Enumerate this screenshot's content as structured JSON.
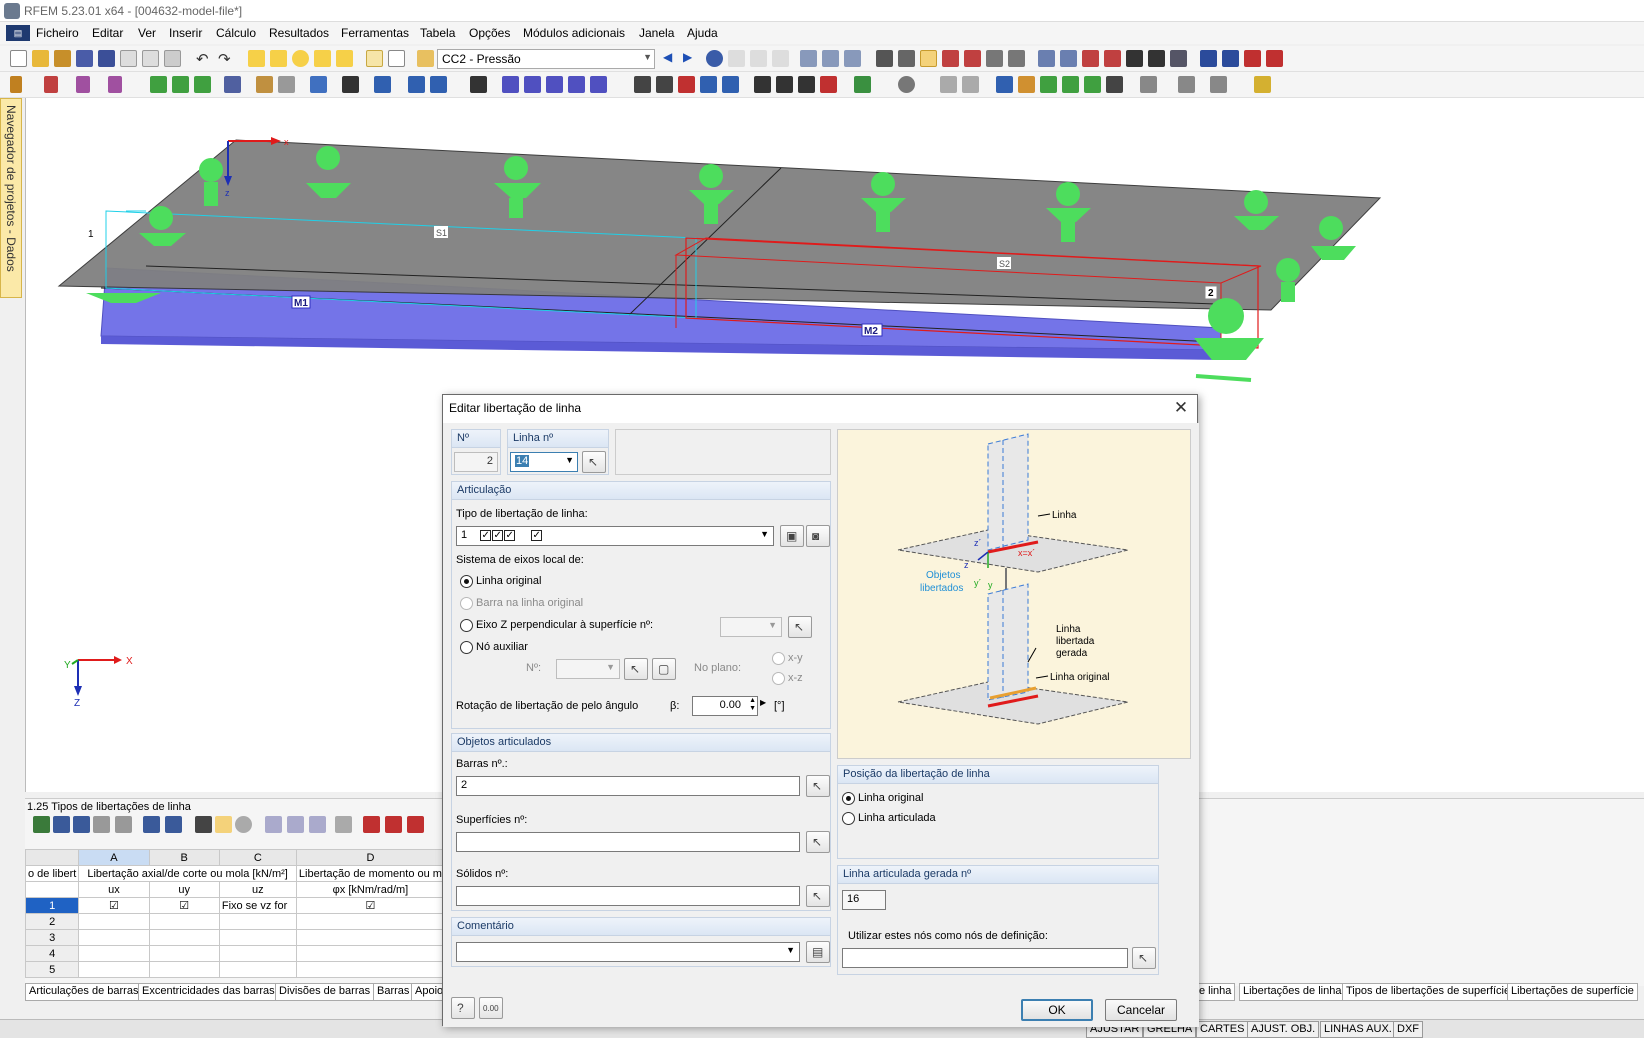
{
  "window": {
    "title": "RFEM 5.23.01 x64 - [004632-model-file*]"
  },
  "menu": [
    "Ficheiro",
    "Editar",
    "Ver",
    "Inserir",
    "Cálculo",
    "Resultados",
    "Ferramentas",
    "Tabela",
    "Opções",
    "Módulos adicionais",
    "Janela",
    "Ajuda"
  ],
  "toolbar": {
    "load_case": "CC2 - Pressão"
  },
  "navigator": {
    "label": "Navegador de projetos - Dados"
  },
  "viewport": {
    "labels": {
      "s1": "S1",
      "s2": "S2",
      "m1": "M1",
      "m2": "M2",
      "node1": "1",
      "node2": "2",
      "axis_x": "x",
      "axis_z": "z",
      "axis_y": "y",
      "axis2_x": "X",
      "axis2_y": "Y",
      "axis2_z": "Z"
    },
    "colors": {
      "slab": "#808080",
      "beam": "#6b6be8",
      "support": "#44dd55",
      "release": "#e01b1b",
      "cyan": "#20d0e8"
    }
  },
  "table_panel": {
    "title": "1.25 Tipos de libertações de linha",
    "col_letters": [
      "A",
      "B",
      "C",
      "D"
    ],
    "header1": [
      "o de libert",
      "Libertação axial/de corte ou mola [kN/m²]",
      "Libertação de momento ou m"
    ],
    "header2": [
      "ux",
      "uy",
      "uz",
      "φx [kNm/rad/m]"
    ],
    "rows": [
      {
        "n": "1",
        "a": "☑",
        "b": "☑",
        "c": "Fixo se vz for",
        "d": "☑"
      },
      {
        "n": "2",
        "a": "",
        "b": "",
        "c": "",
        "d": ""
      },
      {
        "n": "3",
        "a": "",
        "b": "",
        "c": "",
        "d": ""
      },
      {
        "n": "4",
        "a": "",
        "b": "",
        "c": "",
        "d": ""
      },
      {
        "n": "5",
        "a": "",
        "b": "",
        "c": "",
        "d": ""
      }
    ],
    "tabs_left": [
      "Articulações de barras",
      "Excentricidades das barras",
      "Divisões de barras",
      "Barras",
      "Apoio"
    ],
    "tabs_right": [
      "e linha",
      "Libertações de linha",
      "Tipos de libertações de superfície",
      "Libertações de superfície"
    ]
  },
  "statusbar": [
    "AJUSTAR",
    "GRELHA",
    "CARTES",
    "AJUST. OBJ.",
    "LINHAS AUX.",
    "DXF"
  ],
  "dialog": {
    "title": "Editar libertação de linha",
    "no_label": "Nº",
    "no_value": "2",
    "line_label": "Linha nº",
    "line_value": "14",
    "articulation": {
      "title": "Articulação",
      "type_label": "Tipo de libertação de linha:",
      "type_value": "1",
      "axis_label": "Sistema de eixos local de:",
      "opt_original": "Linha original",
      "opt_bar": "Barra na linha original",
      "opt_z": "Eixo Z perpendicular à superfície nº:",
      "opt_node": "Nó auxiliar",
      "node_no": "Nº:",
      "plane_label": "No plano:",
      "plane_xy": "x-y",
      "plane_xz": "x-z",
      "rotation_label": "Rotação de libertação de pelo ângulo",
      "beta": "β:",
      "beta_value": "0.00",
      "unit": "[°]"
    },
    "objects": {
      "title": "Objetos articulados",
      "bars_label": "Barras nº.:",
      "bars_value": "2",
      "surfaces_label": "Superfícies nº:",
      "surfaces_value": "",
      "solids_label": "Sólidos nº:",
      "solids_value": ""
    },
    "comment": {
      "title": "Comentário",
      "value": ""
    },
    "illustration": {
      "linha": "Linha",
      "objetos": "Objetos",
      "libertados": "libertados",
      "linha_libertada_1": "Linha",
      "linha_libertada_2": "libertada",
      "linha_libertada_3": "gerada",
      "linha_original": "Linha original",
      "ax_z": "z´",
      "ax_x": "x=x´",
      "ax_z2": "z",
      "ax_y1": "y´",
      "ax_y2": "y"
    },
    "position": {
      "title": "Posição da libertação de linha",
      "opt_original": "Linha original",
      "opt_articulated": "Linha articulada"
    },
    "generated": {
      "title": "Linha articulada gerada nº",
      "value": "16",
      "nodes_label": "Utilizar estes nós como nós de definição:",
      "nodes_value": ""
    },
    "ok": "OK",
    "cancel": "Cancelar",
    "zero_btn": "0.00"
  }
}
